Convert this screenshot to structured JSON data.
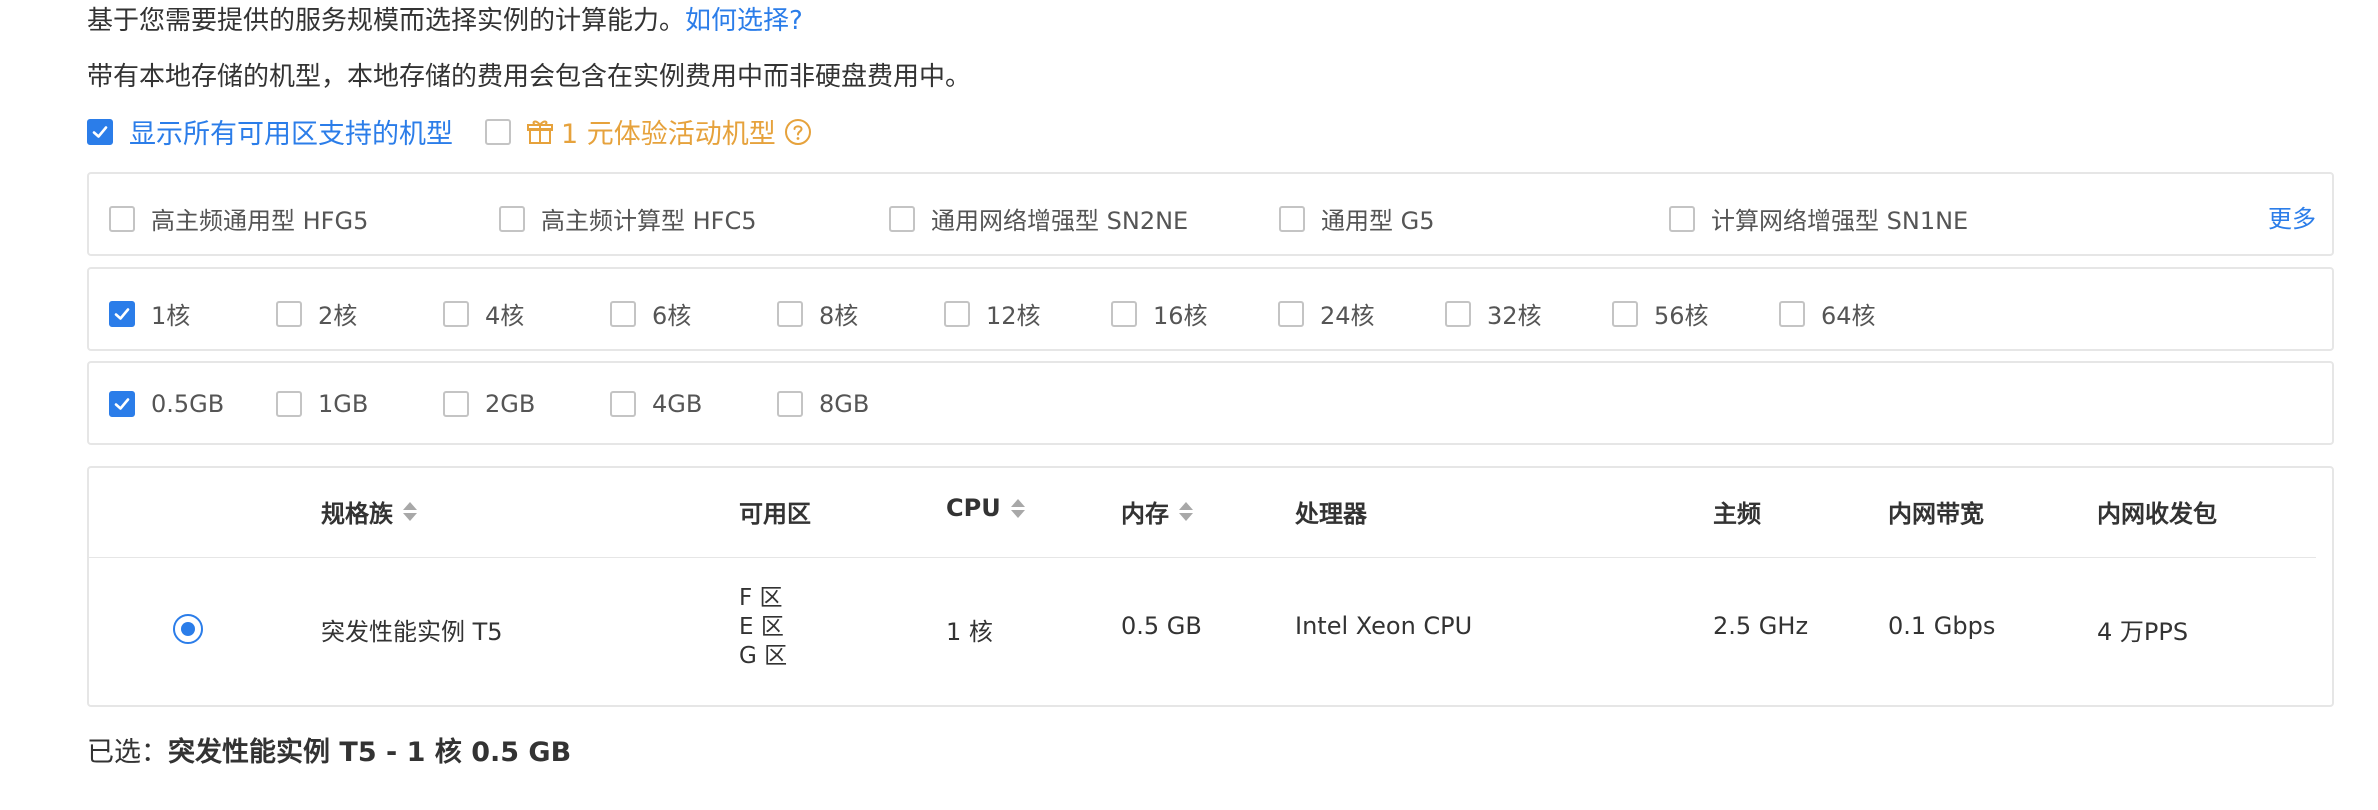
{
  "intro": {
    "line1": "基于您需要提供的服务规模而选择实例的计算能力。",
    "line1_link": "如何选择?",
    "line2": "带有本地存储的机型，本地存储的费用会包含在实例费用中而非硬盘费用中。"
  },
  "options": {
    "show_all_zones": {
      "label": "显示所有可用区支持的机型",
      "checked": true
    },
    "trial": {
      "label": "1 元体验活动机型",
      "checked": false
    }
  },
  "families": {
    "items": [
      {
        "label": "高主频通用型 HFG5",
        "checked": false
      },
      {
        "label": "高主频计算型 HFC5",
        "checked": false
      },
      {
        "label": "通用网络增强型 SN2NE",
        "checked": false
      },
      {
        "label": "通用型 G5",
        "checked": false
      },
      {
        "label": "计算网络增强型 SN1NE",
        "checked": false
      }
    ],
    "more": "更多"
  },
  "cpu": {
    "items": [
      {
        "label": "1核",
        "checked": true
      },
      {
        "label": "2核",
        "checked": false
      },
      {
        "label": "4核",
        "checked": false
      },
      {
        "label": "6核",
        "checked": false
      },
      {
        "label": "8核",
        "checked": false
      },
      {
        "label": "12核",
        "checked": false
      },
      {
        "label": "16核",
        "checked": false
      },
      {
        "label": "24核",
        "checked": false
      },
      {
        "label": "32核",
        "checked": false
      },
      {
        "label": "56核",
        "checked": false
      },
      {
        "label": "64核",
        "checked": false
      }
    ]
  },
  "memory": {
    "items": [
      {
        "label": "0.5GB",
        "checked": true
      },
      {
        "label": "1GB",
        "checked": false
      },
      {
        "label": "2GB",
        "checked": false
      },
      {
        "label": "4GB",
        "checked": false
      },
      {
        "label": "8GB",
        "checked": false
      }
    ]
  },
  "table": {
    "headers": {
      "family": "规格族",
      "zone": "可用区",
      "cpu": "CPU",
      "memory": "内存",
      "processor": "处理器",
      "frequency": "主频",
      "bandwidth": "内网带宽",
      "pps": "内网收发包"
    },
    "rows": [
      {
        "selected": true,
        "family": "突发性能实例 T5",
        "zones": [
          "F 区",
          "E 区",
          "G 区"
        ],
        "cpu": "1 核",
        "memory": "0.5 GB",
        "processor": "Intel Xeon CPU",
        "frequency": "2.5 GHz",
        "bandwidth": "0.1 Gbps",
        "pps": "4 万PPS"
      }
    ]
  },
  "selection": {
    "prefix": "已选：",
    "value": "突发性能实例 T5 - 1 核 0.5 GB"
  },
  "colors": {
    "accent": "#2b7de9",
    "promo": "#e6a23c",
    "border": "#e6e6e6"
  }
}
